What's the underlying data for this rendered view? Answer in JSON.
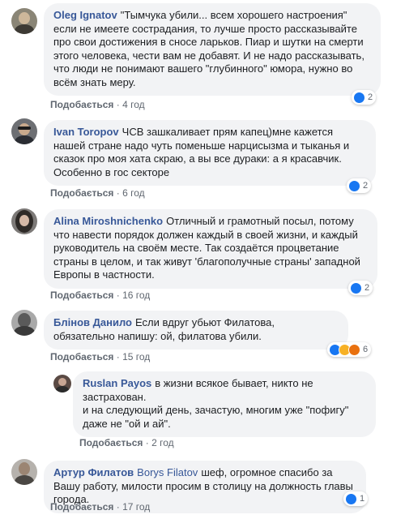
{
  "action_like_label": "Подобається",
  "separator": "·",
  "comments": [
    {
      "author": "Oleg Ignatov",
      "text": "\"Тымчука убили... всем хорошего настроения\" если не имеете сострадания, то лучше просто рассказывайте про свои достижения в сносе ларьков. Пиар и шутки на смерти этого человека, чести вам не добавят. И не надо рассказывать, что люди не понимают вашего \"глубинного\" юмора, нужно во всём знать меру.",
      "time": "4 год",
      "reaction_count": "2"
    },
    {
      "author": "Ivan Toropov",
      "text": "ЧСВ зашкаливает прям капец)мне кажется нашей стране надо чуть поменьше нарцисызма и тыканья и сказок про моя хата скраю, а вы все дураки: а я красавчик. Особенно в гос секторе",
      "time": "6 год",
      "reaction_count": "2"
    },
    {
      "author": "Alina Miroshnichenko",
      "text": "Отличный и грамотный посыл, потому что навести порядок должен каждый в своей жизни, и каждый руководитель на своём месте. Так создаётся процветание страны в целом, и так живут 'благополучные страны' западной Европы в частности.",
      "time": "16 год",
      "reaction_count": "2"
    },
    {
      "author": "Блінов Данило",
      "text": "Если вдруг убьют Филатова, обязательно напишу: ой, филатова убили.",
      "time": "15 год",
      "reaction_count": "6"
    },
    {
      "author": "Ruslan Payos",
      "text_line1": "в жизни всякое бывает, никто не застрахован.",
      "text_line2": "и на следующий день, зачастую, многим уже \"пофигу\" даже не \"ой и ай\".",
      "time": "2 год"
    },
    {
      "author": "Артур Филатов",
      "mention": "Borys Filatov",
      "text": "шеф, огромное спасибо за Вашу работу, милости просим в столицу на должность главы города.",
      "time": "17 год",
      "reaction_count": "1"
    }
  ]
}
